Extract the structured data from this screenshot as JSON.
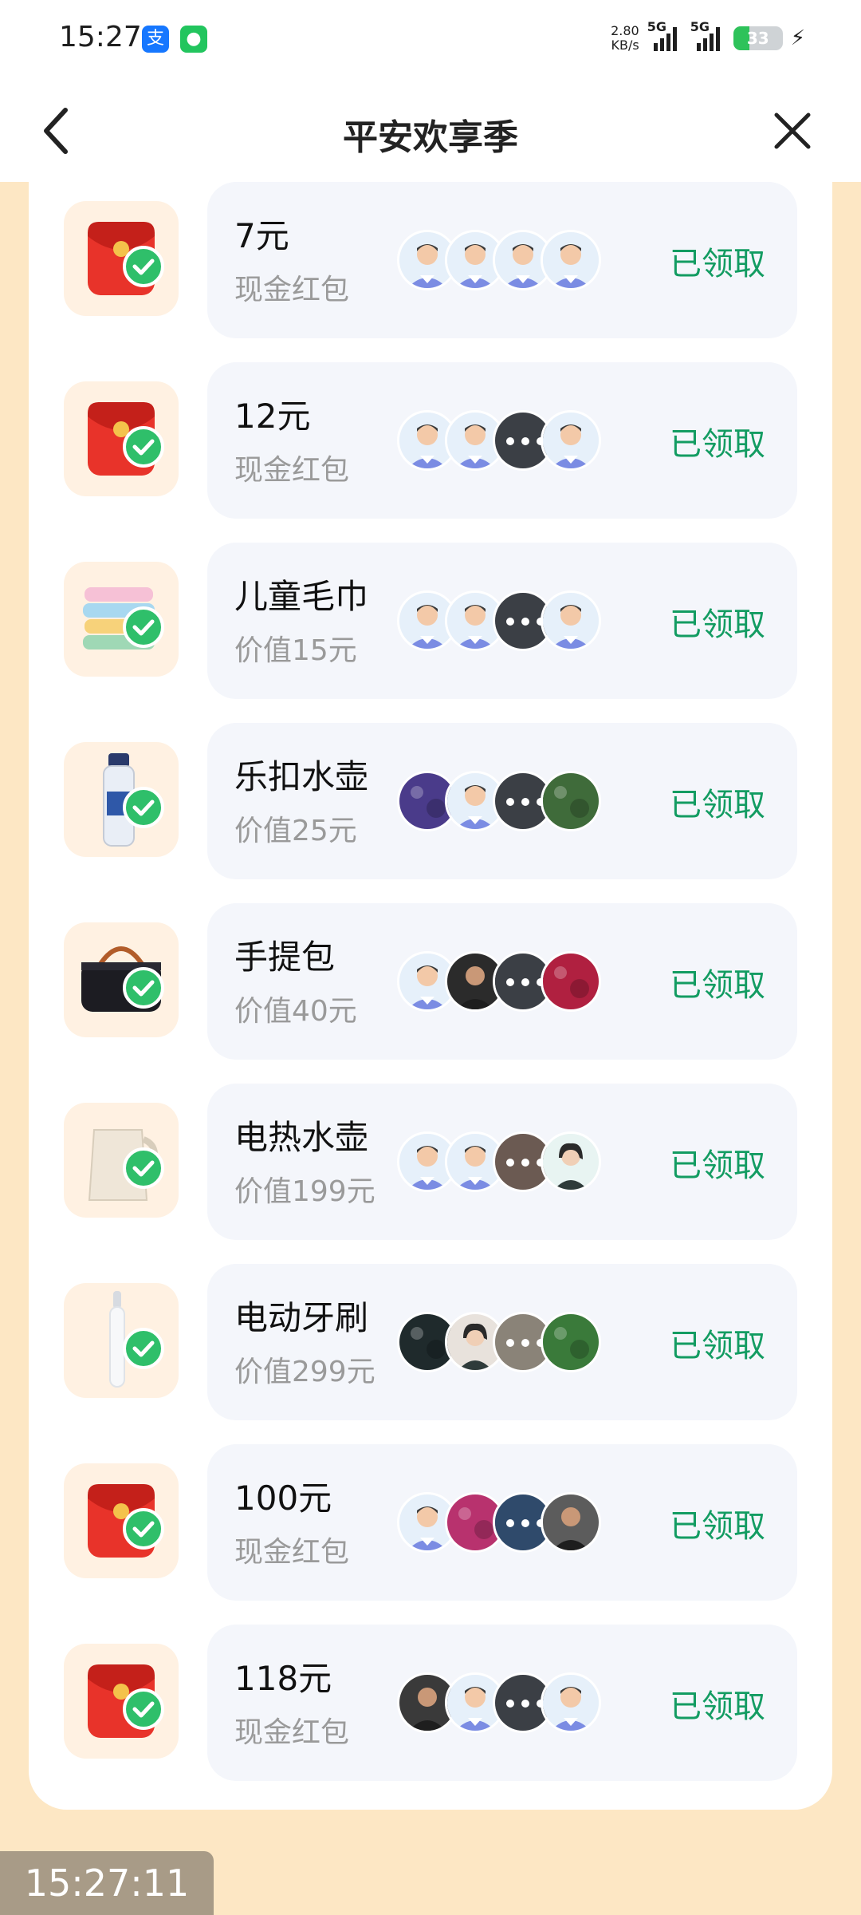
{
  "status_bar": {
    "time": "15:27",
    "speed_value": "2.80",
    "speed_unit": "KB/s",
    "net1": "5G",
    "net2": "5G",
    "battery": "33",
    "battery_level": 0.33
  },
  "header": {
    "title": "平安欢享季"
  },
  "rewards": [
    {
      "name": "7元",
      "desc": "现金红包",
      "status": "已领取",
      "prize": "red-envelope",
      "avatars": [
        "default",
        "default",
        "default",
        "default"
      ]
    },
    {
      "name": "12元",
      "desc": "现金红包",
      "status": "已领取",
      "prize": "red-envelope",
      "avatars": [
        "default",
        "default",
        "masked-dark",
        "default"
      ]
    },
    {
      "name": "儿童毛巾",
      "desc": "价值15元",
      "status": "已领取",
      "prize": "towels",
      "avatars": [
        "default",
        "default",
        "masked-dark",
        "default"
      ]
    },
    {
      "name": "乐扣水壶",
      "desc": "价值25元",
      "status": "已领取",
      "prize": "water-bottle",
      "avatars": [
        "flowers",
        "default",
        "masked-dark",
        "forest"
      ]
    },
    {
      "name": "手提包",
      "desc": "价值40元",
      "status": "已领取",
      "prize": "handbag",
      "avatars": [
        "default",
        "person",
        "masked-dark",
        "red-tree"
      ]
    },
    {
      "name": "电热水壶",
      "desc": "价值199元",
      "status": "已领取",
      "prize": "kettle",
      "avatars": [
        "default",
        "default",
        "masked-brown",
        "woman"
      ]
    },
    {
      "name": "电动牙刷",
      "desc": "价值299元",
      "status": "已领取",
      "prize": "toothbrush",
      "avatars": [
        "dark-leaf",
        "person-light",
        "masked-gray",
        "tulips"
      ]
    },
    {
      "name": "100元",
      "desc": "现金红包",
      "status": "已领取",
      "prize": "red-envelope",
      "avatars": [
        "default",
        "pink-flowers",
        "masked-blue",
        "person-gray"
      ]
    },
    {
      "name": "118元",
      "desc": "现金红包",
      "status": "已领取",
      "prize": "red-envelope",
      "avatars": [
        "person-dark",
        "default",
        "masked-dark",
        "default"
      ]
    }
  ],
  "overlay_time": "15:27:11"
}
